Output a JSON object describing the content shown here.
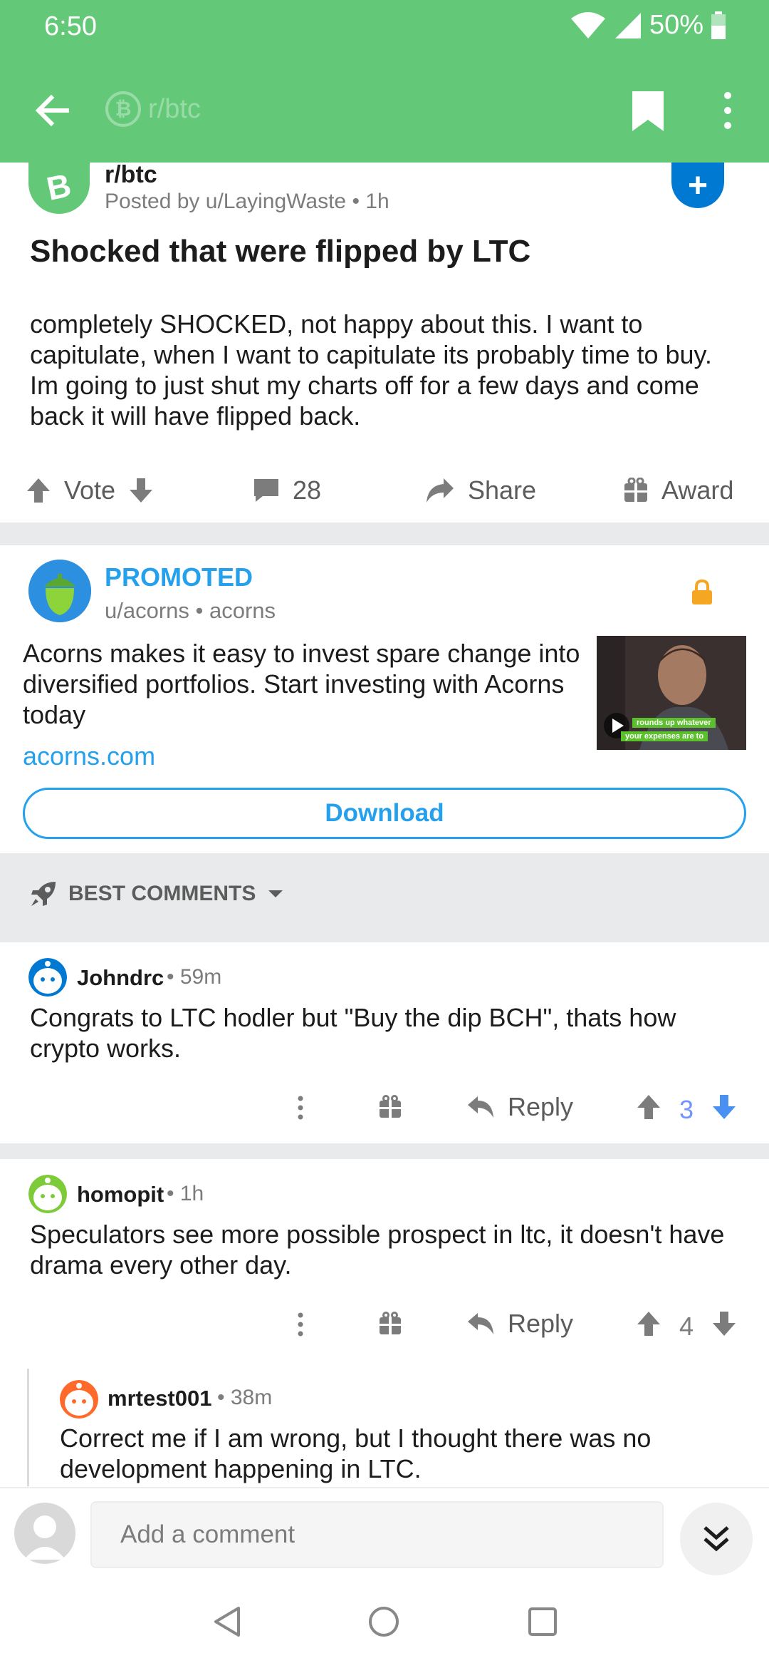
{
  "status": {
    "time": "6:50",
    "battery": "50%"
  },
  "toolbar": {
    "subreddit": "r/btc"
  },
  "post": {
    "subreddit": "r/btc",
    "posted_by": "Posted by u/LayingWaste",
    "age": "1h",
    "title": "Shocked that were flipped by LTC",
    "body": "completely SHOCKED, not happy about this. I want to capitulate, when I want to capitulate its probably time to buy. Im going to just shut my charts off for a few days and come back it will have flipped back.",
    "vote_label": "Vote",
    "comments_count": "28",
    "share_label": "Share",
    "award_label": "Award"
  },
  "promo": {
    "label": "PROMOTED",
    "user": "u/acorns",
    "community": "acorns",
    "text": "Acorns makes it easy to invest spare change into diversified portfolios. Start investing with Acorns today",
    "link": "acorns.com",
    "thumb_caption_1": "rounds up whatever",
    "thumb_caption_2": "your expenses are to",
    "button": "Download"
  },
  "sort": {
    "label": "BEST COMMENTS"
  },
  "comments": [
    {
      "user": "Johndrc",
      "age": "59m",
      "text": "Congrats to LTC hodler but \"Buy the dip BCH\", thats how crypto works.",
      "reply": "Reply",
      "score": "3"
    },
    {
      "user": "homopit",
      "age": "1h",
      "text": "Speculators see more possible prospect in ltc, it doesn't have drama every other day.",
      "reply": "Reply",
      "score": "4"
    },
    {
      "user": "mrtest001",
      "age": "38m",
      "text": "Correct me if I am wrong, but I thought there was no development happening in LTC."
    }
  ],
  "composer": {
    "placeholder": "Add a comment"
  },
  "colors": {
    "brand_green": "#63c978",
    "link_blue": "#24a0ed",
    "upvoted_blue": "#7193ff"
  }
}
